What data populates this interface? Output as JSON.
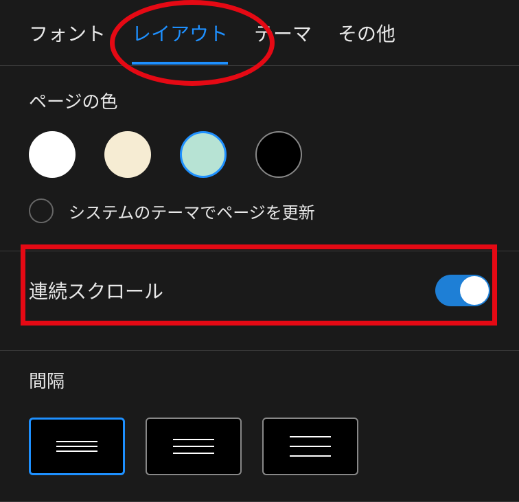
{
  "tabs": {
    "font": {
      "label": "フォント"
    },
    "layout": {
      "label": "レイアウト",
      "active": true
    },
    "theme": {
      "label": "テーマ"
    },
    "other": {
      "label": "その他"
    }
  },
  "page_color": {
    "title": "ページの色",
    "options": [
      {
        "name": "white-swatch",
        "color": "#ffffff"
      },
      {
        "name": "sepia-swatch",
        "color": "#f6ecd3"
      },
      {
        "name": "mint-swatch",
        "color": "#b7e3d4",
        "selected": true
      },
      {
        "name": "black-swatch",
        "color": "#000000"
      }
    ],
    "system_theme_checkbox": {
      "checked": false,
      "label": "システムのテーマでページを更新"
    }
  },
  "continuous_scroll": {
    "label": "連続スクロール",
    "enabled": true
  },
  "spacing": {
    "title": "間隔",
    "options": [
      {
        "name": "spacing-tight",
        "selected": true
      },
      {
        "name": "spacing-medium",
        "selected": false
      },
      {
        "name": "spacing-wide",
        "selected": false
      }
    ]
  },
  "annotations": {
    "ellipse_color": "#e50914",
    "rect_color": "#e50914"
  }
}
